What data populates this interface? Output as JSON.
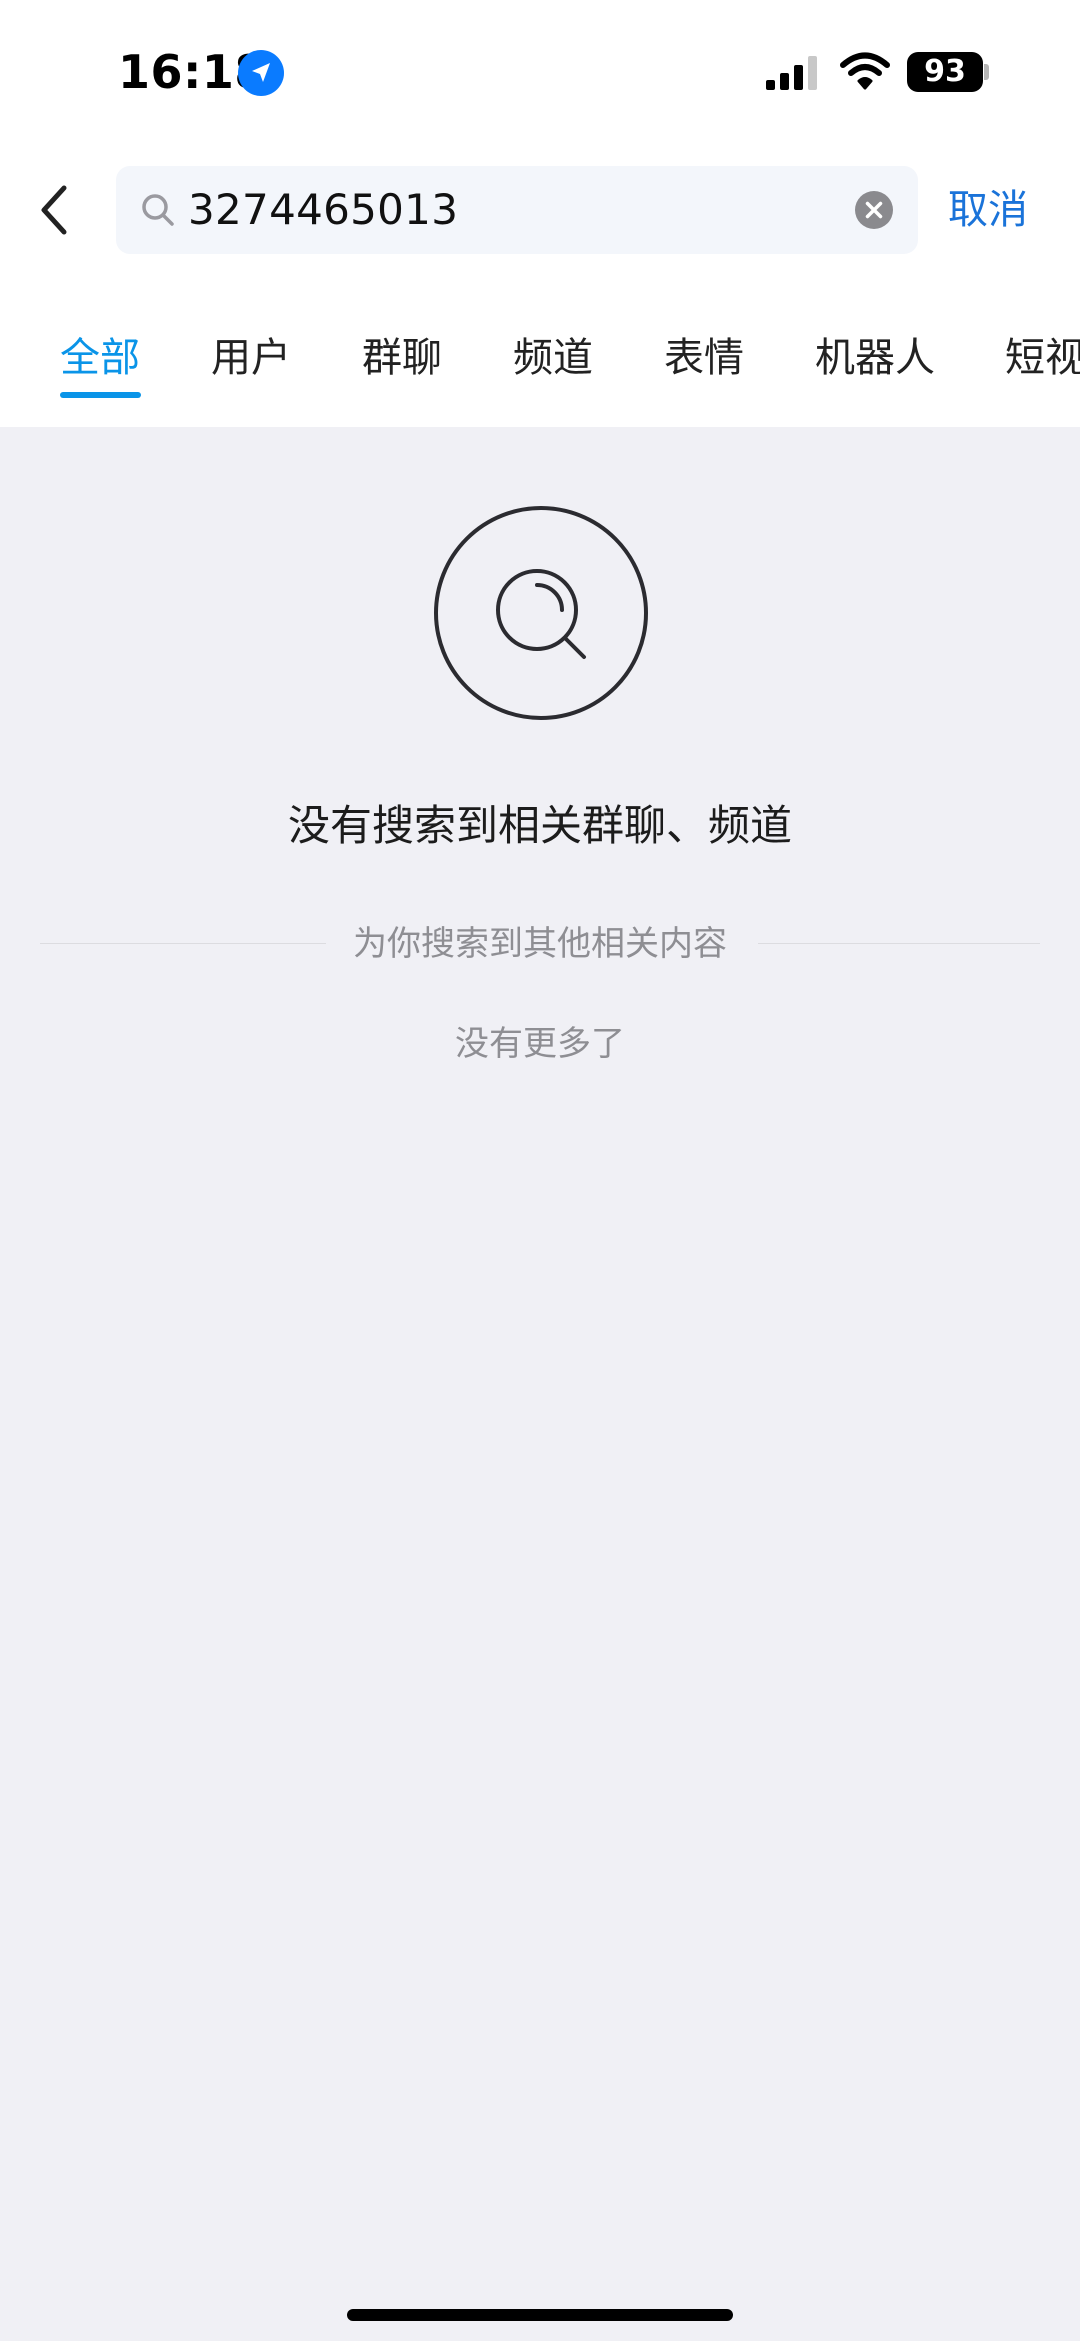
{
  "status_bar": {
    "time": "16:18",
    "battery": "93"
  },
  "search": {
    "value": "3274465013",
    "cancel_label": "取消"
  },
  "tabs": [
    {
      "label": "全部",
      "active": true
    },
    {
      "label": "用户",
      "active": false
    },
    {
      "label": "群聊",
      "active": false
    },
    {
      "label": "频道",
      "active": false
    },
    {
      "label": "表情",
      "active": false
    },
    {
      "label": "机器人",
      "active": false
    },
    {
      "label": "短视",
      "active": false
    }
  ],
  "empty_state": {
    "title": "没有搜索到相关群聊、频道",
    "divider_text": "为你搜索到其他相关内容",
    "no_more": "没有更多了"
  },
  "colors": {
    "accent": "#0a94e8",
    "cancel": "#1a73d9",
    "background": "#f0f0f5"
  }
}
